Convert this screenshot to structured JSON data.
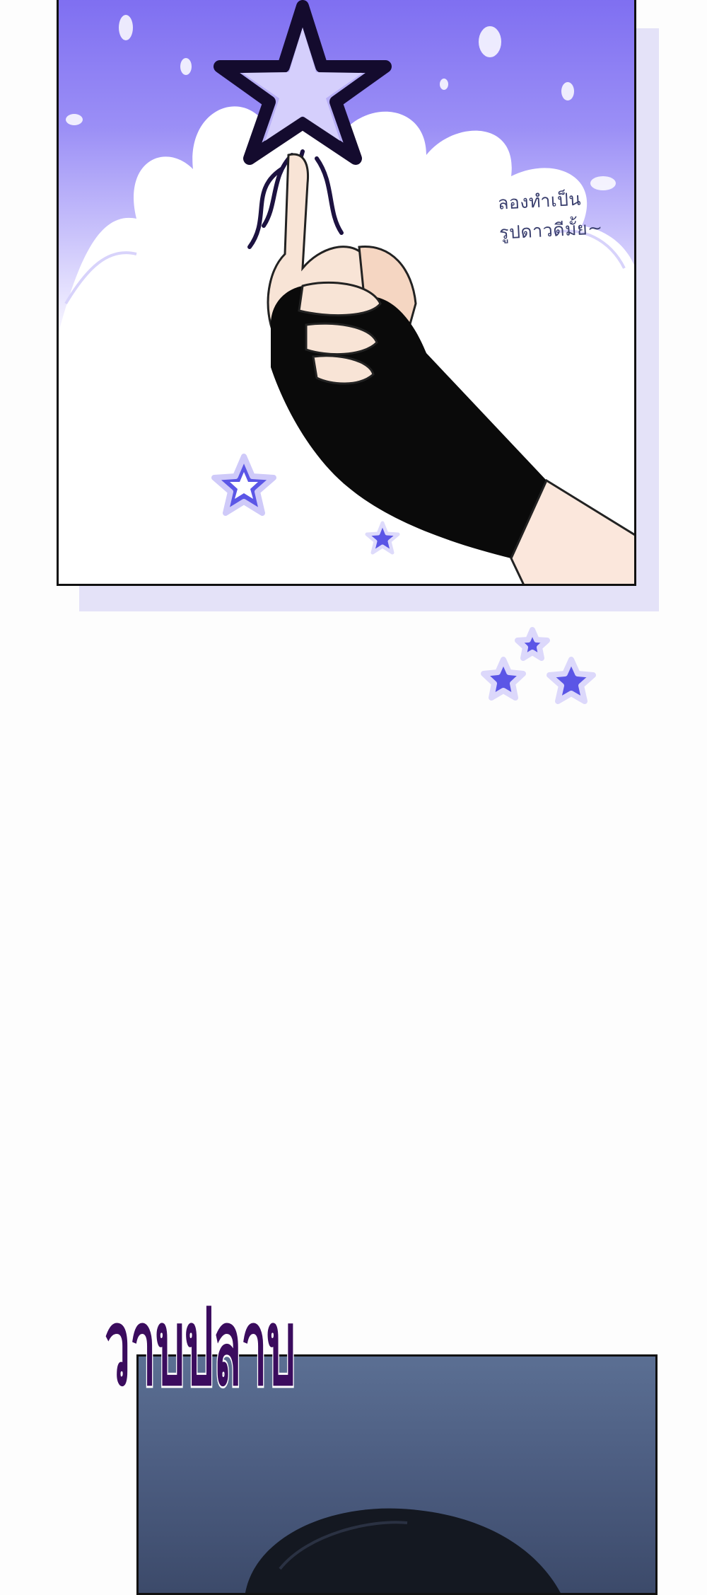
{
  "panel_top": {
    "dialogue_lines": [
      "ลองทำเป็น",
      "รูปดาวดีมั้ย~"
    ]
  },
  "sound_effect": {
    "text": "วาบปลาบ"
  },
  "colors": {
    "sky_purple": "#7f6ff1",
    "star_blue": "#5b56e6",
    "glove_black": "#0a0a0a",
    "sfx_purple": "#3b0c5e",
    "lower_panel_blue": "#4d5e82"
  },
  "icons": [
    "dark-star-icon",
    "outline-star-icon",
    "small-star-icon",
    "star-cluster-icon"
  ]
}
